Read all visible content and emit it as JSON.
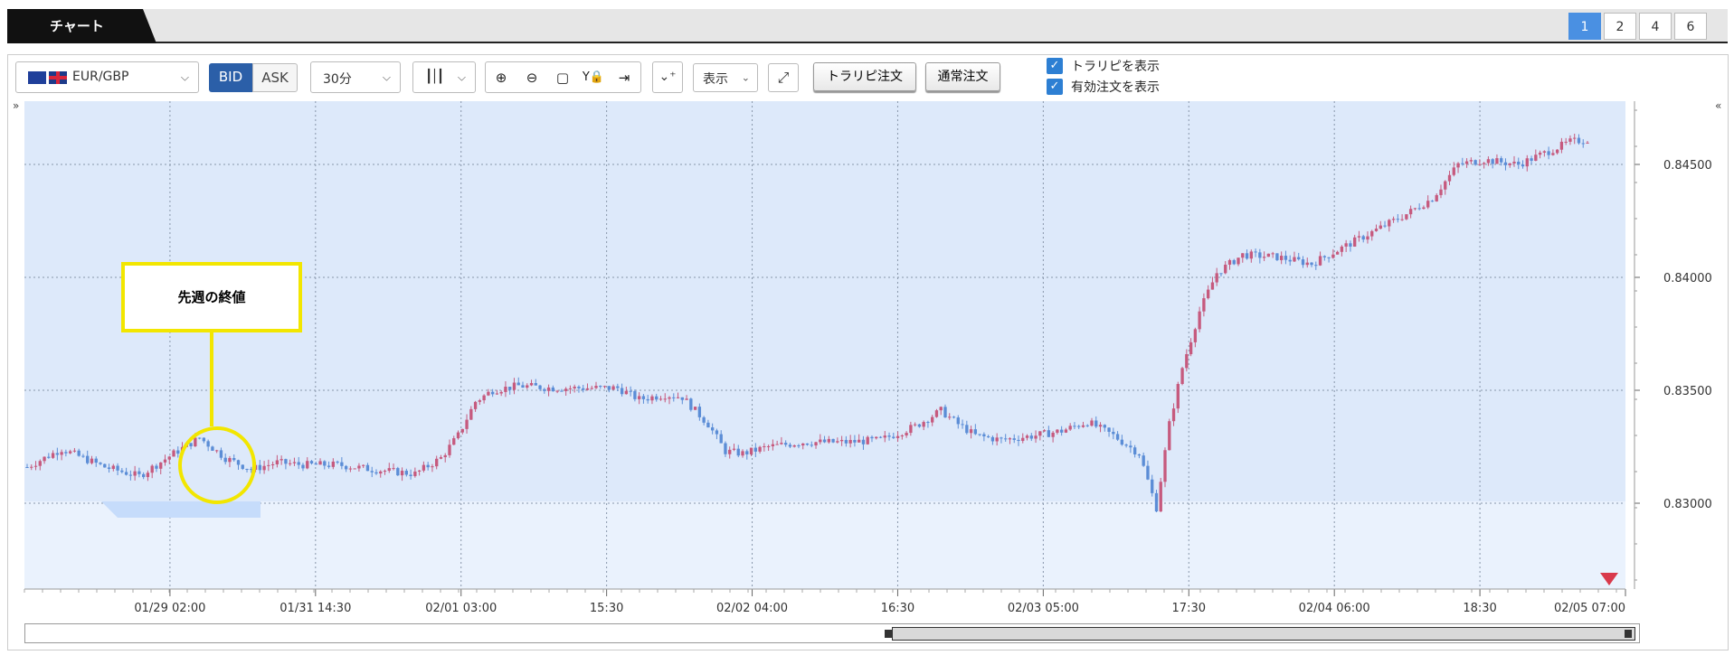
{
  "header": {
    "tab_title": "チャート",
    "pages": [
      "1",
      "2",
      "4",
      "6"
    ],
    "active_page": "1"
  },
  "toolbar": {
    "symbol": "EUR/GBP",
    "bid_label": "BID",
    "ask_label": "ASK",
    "timeframe": "30分",
    "display_label": "表示",
    "trail_order_label": "トラリピ注文",
    "normal_order_label": "通常注文",
    "show_trail_label": "トラリピを表示",
    "show_active_label": "有効注文を表示",
    "colors": {
      "bid_active": "#2b5fa8"
    }
  },
  "annotation": {
    "text": "先週の終値"
  },
  "colors": {
    "up": "#c65a7e",
    "down": "#5b8dd6",
    "plot_bg": "#dde9fa",
    "plot_bg_lower": "#eaf2fd",
    "accent_marker": "#d9394b",
    "highlight": "#f2e600"
  },
  "chart_data": {
    "type": "candlestick",
    "symbol": "EUR/GBP",
    "timeframe": "30分",
    "y_ticks": [
      "0.84500",
      "0.84000",
      "0.83500",
      "0.83000"
    ],
    "y_tick_values": [
      0.845,
      0.84,
      0.835,
      0.83
    ],
    "ylim": [
      0.8262,
      0.8478
    ],
    "x_ticks": [
      "01/29 02:00",
      "01/31 14:30",
      "02/01 03:00",
      "15:30",
      "02/02 04:00",
      "16:30",
      "02/03 05:00",
      "17:30",
      "02/04 06:00",
      "18:30",
      "02/05 07:00"
    ],
    "price_path": [
      [
        0,
        0.8316
      ],
      [
        8,
        0.8324
      ],
      [
        18,
        0.8316
      ],
      [
        26,
        0.8312
      ],
      [
        34,
        0.8322
      ],
      [
        40,
        0.8329
      ],
      [
        46,
        0.832
      ],
      [
        52,
        0.8315
      ],
      [
        58,
        0.8318
      ],
      [
        64,
        0.8317
      ],
      [
        72,
        0.8317
      ],
      [
        80,
        0.8315
      ],
      [
        90,
        0.8313
      ],
      [
        96,
        0.832
      ],
      [
        100,
        0.833
      ],
      [
        104,
        0.8345
      ],
      [
        108,
        0.835
      ],
      [
        114,
        0.8352
      ],
      [
        122,
        0.8351
      ],
      [
        130,
        0.8351
      ],
      [
        137,
        0.8351
      ],
      [
        142,
        0.8346
      ],
      [
        148,
        0.8348
      ],
      [
        152,
        0.8347
      ],
      [
        158,
        0.8335
      ],
      [
        162,
        0.8323
      ],
      [
        166,
        0.8322
      ],
      [
        172,
        0.8325
      ],
      [
        180,
        0.8327
      ],
      [
        190,
        0.8327
      ],
      [
        198,
        0.8328
      ],
      [
        206,
        0.8334
      ],
      [
        212,
        0.8341
      ],
      [
        216,
        0.8335
      ],
      [
        220,
        0.833
      ],
      [
        226,
        0.8328
      ],
      [
        234,
        0.833
      ],
      [
        240,
        0.8332
      ],
      [
        246,
        0.8336
      ],
      [
        252,
        0.833
      ],
      [
        258,
        0.8322
      ],
      [
        262,
        0.8298
      ],
      [
        265,
        0.8335
      ],
      [
        268,
        0.836
      ],
      [
        272,
        0.8385
      ],
      [
        276,
        0.8402
      ],
      [
        282,
        0.841
      ],
      [
        290,
        0.8409
      ],
      [
        298,
        0.8406
      ],
      [
        304,
        0.8412
      ],
      [
        312,
        0.842
      ],
      [
        320,
        0.8428
      ],
      [
        326,
        0.8435
      ],
      [
        332,
        0.845
      ],
      [
        338,
        0.8452
      ],
      [
        346,
        0.845
      ],
      [
        352,
        0.8455
      ],
      [
        358,
        0.846
      ],
      [
        362,
        0.8461
      ]
    ]
  }
}
